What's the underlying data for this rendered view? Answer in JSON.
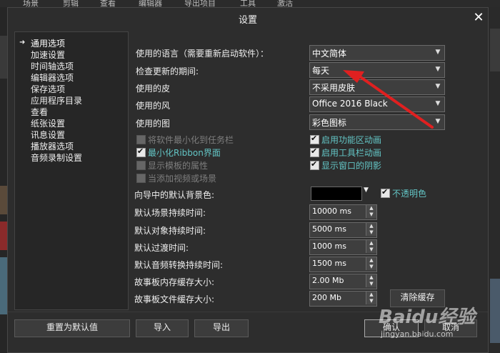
{
  "background_app": {
    "menu": [
      "场景",
      "剪辑",
      "查看",
      "编辑器",
      "导出项目",
      "工具",
      "激活"
    ]
  },
  "dialog": {
    "title": "设置",
    "close_icon": "close-icon"
  },
  "nav": {
    "items": [
      "通用选项",
      "加速设置",
      "时间轴选项",
      "编辑器选项",
      "保存选项",
      "应用程序目录",
      "查看",
      "纸张设置",
      "讯息设置",
      "播放器选项",
      "音频录制设置"
    ],
    "selected": "通用选项"
  },
  "general": {
    "language_label": "使用的语言（需要重新启动软件）：",
    "language_value": "中文简体",
    "update_label": "检查更新的期间:",
    "update_value": "每天",
    "skin_label": "使用的皮",
    "skin_value": "不采用皮肤",
    "style_label": "使用的风",
    "style_value": "Office 2016 Black",
    "icon_label": "使用的图",
    "icon_value": "彩色图标"
  },
  "checks": {
    "minimize_tray": {
      "label": "将软件最小化到任务栏",
      "checked": false,
      "enabled": false
    },
    "minimize_ribbon": {
      "label": "最小化Ribbon界面",
      "checked": true,
      "enabled": true
    },
    "show_template_attr": {
      "label": "显示模板的属性",
      "checked": false,
      "enabled": false
    },
    "add_video_scene": {
      "label": "当添加视频或场景",
      "checked": false,
      "enabled": false
    },
    "enable_func_anim": {
      "label": "启用功能区动画",
      "checked": true,
      "enabled": true
    },
    "enable_toolbar_anim": {
      "label": "启用工具栏动画",
      "checked": true,
      "enabled": true
    },
    "show_window_shadow": {
      "label": "显示窗口的阴影",
      "checked": true,
      "enabled": true
    }
  },
  "wizard": {
    "bg_color_label": "向导中的默认背景色:",
    "bg_color": "#000000",
    "opaque_label": "不透明色",
    "opaque_checked": true
  },
  "durations": [
    {
      "label": "默认场景持续时间:",
      "value": "10000 ms"
    },
    {
      "label": "默认对象持续时间:",
      "value": "5000 ms"
    },
    {
      "label": "默认过渡时间:",
      "value": "1000 ms"
    },
    {
      "label": "默认音频转换持续时间:",
      "value": "1500 ms"
    },
    {
      "label": "故事板内存缓存大小:",
      "value": "2.00 Mb"
    },
    {
      "label": "故事板文件缓存大小:",
      "value": "200 Mb"
    }
  ],
  "buttons": {
    "clear_cache": "清除缓存",
    "reset_default": "重置为默认值",
    "import": "导入",
    "export": "导出",
    "ok": "确认",
    "cancel": "取消"
  },
  "watermark": {
    "line1": "Baidu经验",
    "line2": "jingyan.baidu.com"
  },
  "colors": {
    "accent_text": "#63c5c5",
    "annotation_arrow": "#e02020",
    "dialog_bg": "#2d2d2d"
  }
}
